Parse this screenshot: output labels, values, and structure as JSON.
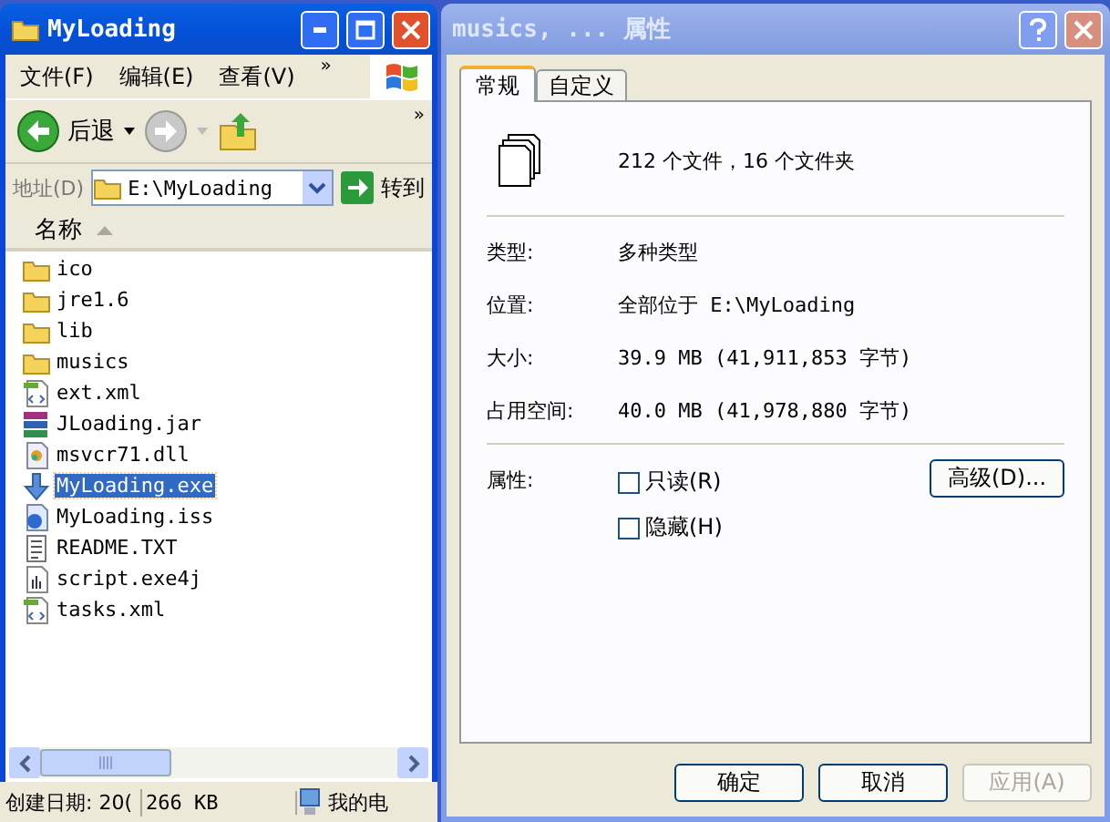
{
  "explorer": {
    "title": "MyLoading",
    "menu": [
      "文件(F)",
      "编辑(E)",
      "查看(V)"
    ],
    "menu_more": "»",
    "toolbar_more": "»",
    "back": "后退",
    "address_label": "地址(D)",
    "address": "E:\\MyLoading",
    "go": "转到",
    "column": "名称",
    "files": [
      {
        "name": "ico",
        "kind": "folder",
        "selected": false
      },
      {
        "name": "jre1.6",
        "kind": "folder",
        "selected": false
      },
      {
        "name": "lib",
        "kind": "folder",
        "selected": false
      },
      {
        "name": "musics",
        "kind": "folder",
        "selected": false
      },
      {
        "name": "ext.xml",
        "kind": "xml",
        "selected": false
      },
      {
        "name": "JLoading.jar",
        "kind": "jar",
        "selected": false
      },
      {
        "name": "msvcr71.dll",
        "kind": "dll",
        "selected": false
      },
      {
        "name": "MyLoading.exe",
        "kind": "exe",
        "selected": true
      },
      {
        "name": "MyLoading.iss",
        "kind": "iss",
        "selected": false
      },
      {
        "name": "README.TXT",
        "kind": "txt",
        "selected": false
      },
      {
        "name": "script.exe4j",
        "kind": "exe4j",
        "selected": false
      },
      {
        "name": "tasks.xml",
        "kind": "xml",
        "selected": false
      }
    ],
    "status": [
      "创建日期: 20(",
      "266 KB",
      "我的电"
    ]
  },
  "properties": {
    "title": "musics, ... 属性",
    "tabs": [
      {
        "label": "常规",
        "selected": true
      },
      {
        "label": "自定义",
        "selected": false
      }
    ],
    "summary": "212 个文件，16 个文件夹",
    "rows": [
      {
        "label": "类型:",
        "value": "多种类型"
      },
      {
        "label": "位置:",
        "value": "全部位于 E:\\MyLoading"
      },
      {
        "label": "大小:",
        "value": "39.9 MB (41,911,853 字节)"
      },
      {
        "label": "占用空间:",
        "value": "40.0 MB (41,978,880 字节)"
      }
    ],
    "attributes_label": "属性:",
    "checkboxes": [
      {
        "label": "只读(R)",
        "checked": false
      },
      {
        "label": "隐藏(H)",
        "checked": false
      }
    ],
    "advanced": "高级(D)...",
    "buttons": [
      {
        "label": "确定",
        "disabled": false
      },
      {
        "label": "取消",
        "disabled": false
      },
      {
        "label": "应用(A)",
        "disabled": true
      }
    ]
  }
}
